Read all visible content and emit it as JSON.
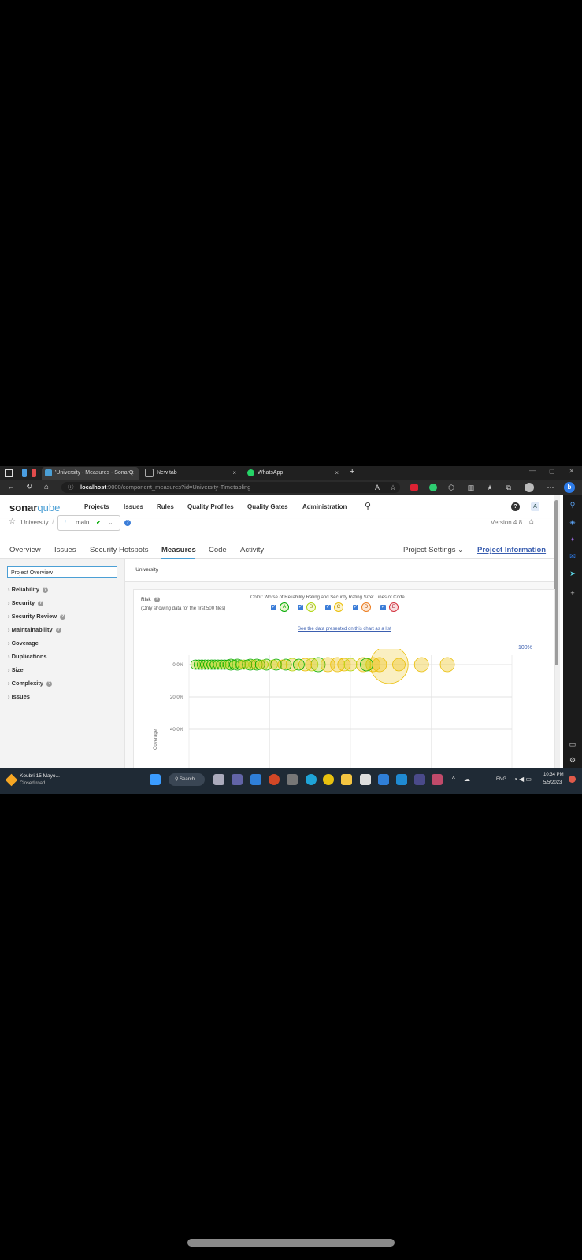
{
  "browser": {
    "tabs": [
      {
        "title": "'University - Measures - SonarQ",
        "close": "×",
        "active": true
      },
      {
        "title": "New tab",
        "close": "×",
        "active": false
      },
      {
        "title": "WhatsApp",
        "close": "×",
        "active": false
      }
    ],
    "new_tab": "+",
    "url_host": "localhost",
    "url_rest": ":9000/component_measures?id=University-Timetabling"
  },
  "sonar": {
    "logo_main": "sonar",
    "logo_accent": "qube",
    "nav": [
      "Projects",
      "Issues",
      "Rules",
      "Quality Profiles",
      "Quality Gates",
      "Administration"
    ],
    "help_btn": "?",
    "avatar": "A"
  },
  "project": {
    "name": "'University",
    "separator": "/",
    "branch": "main",
    "branch_help": "?",
    "version": "Version 4.8",
    "tabs": [
      "Overview",
      "Issues",
      "Security Hotspots",
      "Measures",
      "Code",
      "Activity"
    ],
    "active_tab": "Measures",
    "settings": "Project Settings",
    "info": "Project Information"
  },
  "sidebar": {
    "selected": "Project Overview",
    "items": [
      {
        "label": "Reliability",
        "help": true
      },
      {
        "label": "Security",
        "help": true
      },
      {
        "label": "Security Review",
        "help": true
      },
      {
        "label": "Maintainability",
        "help": true
      },
      {
        "label": "Coverage",
        "help": false
      },
      {
        "label": "Duplications",
        "help": false
      },
      {
        "label": "Size",
        "help": false
      },
      {
        "label": "Complexity",
        "help": true
      },
      {
        "label": "Issues",
        "help": false
      }
    ]
  },
  "main": {
    "breadcrumb": "'University",
    "risk_title": "Risk",
    "risk_note": "(Only showing data for the first 500 files)",
    "color_legend": "Color: Worse of Reliability Rating and Security Rating  Size: Lines of Code",
    "list_link": "See the data presented on this chart as a list",
    "zoom_label": "100%",
    "ratings": [
      {
        "letter": "A",
        "color": "#00aa00",
        "fill": "#b0d513"
      },
      {
        "letter": "B",
        "color": "#b0d513",
        "fill": "#eabe06"
      },
      {
        "letter": "C",
        "color": "#eabe06",
        "fill": "#eabe06"
      },
      {
        "letter": "D",
        "color": "#ed7d20",
        "fill": "#ed7d20"
      },
      {
        "letter": "E",
        "color": "#d4333f",
        "fill": "#d4333f"
      }
    ]
  },
  "chart_data": {
    "type": "scatter",
    "title": "Risk",
    "xlabel": "",
    "ylabel": "Coverage",
    "y_ticks": [
      "0.0%",
      "20.0%",
      "40.0%"
    ],
    "y_inverted": true,
    "size_metric": "Lines of Code",
    "color_metric": "Worse of Reliability Rating and Security Rating",
    "points": [
      {
        "x": 0.02,
        "y": 0,
        "size": 6,
        "rating": "A"
      },
      {
        "x": 0.03,
        "y": 0,
        "size": 6,
        "rating": "A"
      },
      {
        "x": 0.04,
        "y": 0,
        "size": 6,
        "rating": "A"
      },
      {
        "x": 0.05,
        "y": 0,
        "size": 6,
        "rating": "A"
      },
      {
        "x": 0.06,
        "y": 0,
        "size": 6,
        "rating": "A"
      },
      {
        "x": 0.07,
        "y": 0,
        "size": 6,
        "rating": "A"
      },
      {
        "x": 0.08,
        "y": 0,
        "size": 6,
        "rating": "A"
      },
      {
        "x": 0.09,
        "y": 0,
        "size": 6,
        "rating": "A"
      },
      {
        "x": 0.1,
        "y": 0,
        "size": 6,
        "rating": "A"
      },
      {
        "x": 0.11,
        "y": 0,
        "size": 6,
        "rating": "A"
      },
      {
        "x": 0.12,
        "y": 0,
        "size": 6,
        "rating": "A"
      },
      {
        "x": 0.13,
        "y": 0,
        "size": 7,
        "rating": "A"
      },
      {
        "x": 0.14,
        "y": 0,
        "size": 6,
        "rating": "A"
      },
      {
        "x": 0.15,
        "y": 0,
        "size": 7,
        "rating": "A"
      },
      {
        "x": 0.16,
        "y": 0,
        "size": 6,
        "rating": "A"
      },
      {
        "x": 0.17,
        "y": 0,
        "size": 6,
        "rating": "B"
      },
      {
        "x": 0.18,
        "y": 0,
        "size": 6,
        "rating": "A"
      },
      {
        "x": 0.19,
        "y": 0,
        "size": 7,
        "rating": "A"
      },
      {
        "x": 0.2,
        "y": 0,
        "size": 6,
        "rating": "B"
      },
      {
        "x": 0.21,
        "y": 0,
        "size": 7,
        "rating": "A"
      },
      {
        "x": 0.22,
        "y": 0,
        "size": 6,
        "rating": "A"
      },
      {
        "x": 0.23,
        "y": 0,
        "size": 6,
        "rating": "B"
      },
      {
        "x": 0.24,
        "y": 0,
        "size": 7,
        "rating": "A"
      },
      {
        "x": 0.26,
        "y": 0,
        "size": 6,
        "rating": "B"
      },
      {
        "x": 0.27,
        "y": 0,
        "size": 7,
        "rating": "A"
      },
      {
        "x": 0.29,
        "y": 0,
        "size": 6,
        "rating": "C"
      },
      {
        "x": 0.3,
        "y": 0,
        "size": 7,
        "rating": "A"
      },
      {
        "x": 0.32,
        "y": 0,
        "size": 8,
        "rating": "B"
      },
      {
        "x": 0.34,
        "y": 0,
        "size": 7,
        "rating": "A"
      },
      {
        "x": 0.36,
        "y": 0,
        "size": 8,
        "rating": "C"
      },
      {
        "x": 0.38,
        "y": 0,
        "size": 8,
        "rating": "B"
      },
      {
        "x": 0.4,
        "y": 0,
        "size": 9,
        "rating": "A"
      },
      {
        "x": 0.43,
        "y": 0,
        "size": 9,
        "rating": "C"
      },
      {
        "x": 0.46,
        "y": 0,
        "size": 9,
        "rating": "C"
      },
      {
        "x": 0.48,
        "y": 0,
        "size": 8,
        "rating": "C"
      },
      {
        "x": 0.5,
        "y": 0,
        "size": 8,
        "rating": "B"
      },
      {
        "x": 0.54,
        "y": 0,
        "size": 9,
        "rating": "C"
      },
      {
        "x": 0.55,
        "y": 0,
        "size": 8,
        "rating": "A"
      },
      {
        "x": 0.57,
        "y": 0,
        "size": 9,
        "rating": "C"
      },
      {
        "x": 0.59,
        "y": 0,
        "size": 9,
        "rating": "C"
      },
      {
        "x": 0.62,
        "y": 0,
        "size": 24,
        "rating": "C"
      },
      {
        "x": 0.65,
        "y": 0,
        "size": 8,
        "rating": "C"
      },
      {
        "x": 0.72,
        "y": 0,
        "size": 9,
        "rating": "C"
      },
      {
        "x": 0.8,
        "y": 0,
        "size": 9,
        "rating": "C"
      }
    ]
  }
}
